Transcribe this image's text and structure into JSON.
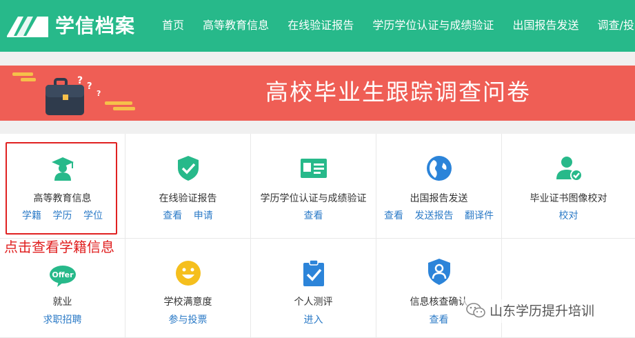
{
  "header": {
    "brand": "学信档案",
    "nav": [
      "首页",
      "高等教育信息",
      "在线验证报告",
      "学历学位认证与成绩验证",
      "出国报告发送",
      "调查/投票"
    ]
  },
  "banner": {
    "title": "高校毕业生跟踪调查问卷"
  },
  "grid": {
    "cells": [
      {
        "title": "高等教育信息",
        "icon": "graduate-icon",
        "links": [
          "学籍",
          "学历",
          "学位"
        ]
      },
      {
        "title": "在线验证报告",
        "icon": "shield-check-icon",
        "links": [
          "查看",
          "申请"
        ]
      },
      {
        "title": "学历学位认证与成绩验证",
        "icon": "id-card-icon",
        "links": [
          "查看"
        ]
      },
      {
        "title": "出国报告发送",
        "icon": "globe-icon",
        "links": [
          "查看",
          "发送报告",
          "翻译件"
        ]
      },
      {
        "title": "毕业证书图像校对",
        "icon": "user-check-icon",
        "links": [
          "校对"
        ]
      },
      {
        "title": "就业",
        "icon": "offer-icon",
        "icon_text": "Offer",
        "links": [
          "求职招聘"
        ]
      },
      {
        "title": "学校满意度",
        "icon": "smiley-icon",
        "links": [
          "参与投票"
        ]
      },
      {
        "title": "个人测评",
        "icon": "clipboard-check-icon",
        "links": [
          "进入"
        ]
      },
      {
        "title": "信息核查确认",
        "icon": "user-shield-icon",
        "links": [
          "查看"
        ]
      }
    ]
  },
  "annotation": {
    "text": "点击查看学籍信息"
  },
  "watermark": {
    "text": "山东学历提升培训"
  },
  "colors": {
    "header": "#27b98a",
    "banner": "#ef5e55",
    "link": "#2c7bc7",
    "annotation": "#e02020"
  }
}
